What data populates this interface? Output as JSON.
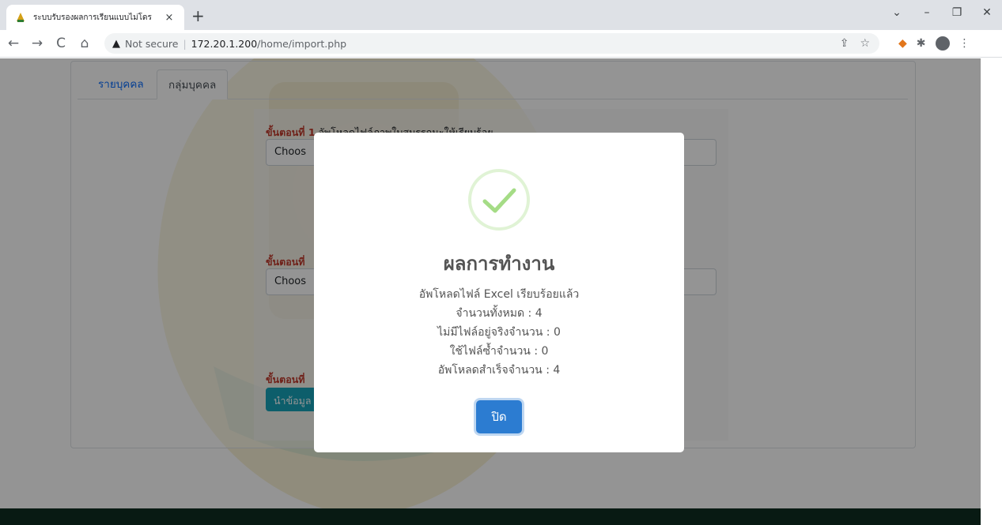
{
  "browser": {
    "tab_title": "ระบบรับรองผลการเรียนแบบไม่โดร",
    "tab_close": "×",
    "new_tab": "+",
    "window_controls": [
      "⌄",
      "–",
      "❐",
      "✕"
    ],
    "security_label": "Not secure",
    "url_host": "172.20.1.200",
    "url_path": "/home/import.php"
  },
  "page": {
    "tabs": [
      "รายบุคคล",
      "กลุ่มบุคคล"
    ],
    "step1_prefix": "ขั้นตอนที่ 1",
    "step1_text": " อัพโหลดไฟล์ภาพใบสมรรถนะให้เรียบร้อย",
    "step2_prefix": "ขั้นตอนที่",
    "step3_prefix": "ขั้นตอนที่",
    "file_input_1": "Choos",
    "file_input_2": "Choos",
    "import_button": "นำข้อมูล"
  },
  "modal": {
    "title": "ผลการทำงาน",
    "message": "อัพโหลดไฟล์ Excel เรียบร้อยแล้ว",
    "total": "จำนวนทั้งหมด : 4",
    "missing": "ไม่มีไฟล์อยู่จริงจำนวน : 0",
    "duplicate": "ใช้ไฟล์ซ้ำจำนวน : 0",
    "success": "อัพโหลดสำเร็จจำนวน : 4",
    "close_button": "ปิด"
  },
  "colors": {
    "success_check": "#a5dc86",
    "close_button": "#2c7cd1",
    "import_button": "#17a2b8",
    "step_label": "#c0392b",
    "footer": "#0f2e21"
  },
  "icons": [
    "warning-icon",
    "check-icon",
    "back-icon",
    "forward-icon",
    "reload-icon",
    "home-icon",
    "share-icon",
    "star-icon",
    "metamask-icon",
    "extensions-icon",
    "profile-icon",
    "menu-icon"
  ]
}
